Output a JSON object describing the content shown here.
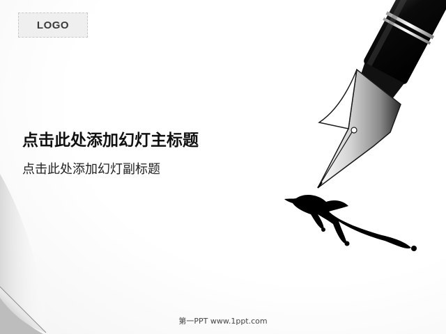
{
  "logo": {
    "text": "LOGO"
  },
  "slide": {
    "main_title": "点击此处添加幻灯主标题",
    "subtitle": "点击此处添加幻灯副标题"
  },
  "footer": {
    "text": "第一PPT  www.1ppt.com"
  },
  "colors": {
    "background": "#ffffff",
    "ink": "#000000",
    "title_text": "#111111",
    "logo_box": "#efefef"
  },
  "icons": {
    "pen": "fountain-pen-icon",
    "ink_splash": "ink-splash-icon",
    "page_curl": "page-curl-icon"
  }
}
